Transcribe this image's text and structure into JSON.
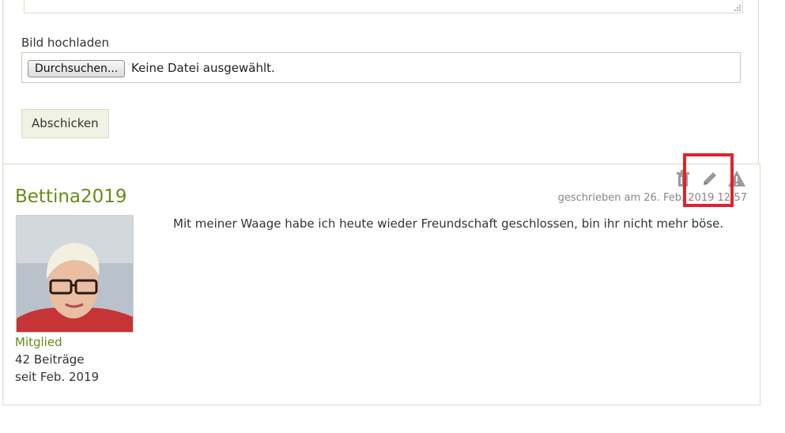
{
  "form": {
    "upload_label": "Bild hochladen",
    "browse_button": "Durchsuchen...",
    "no_file_text": "Keine Datei ausgewählt.",
    "submit_button": "Abschicken"
  },
  "post": {
    "username": "Bettina2019",
    "role": "Mitglied",
    "post_count": "42 Beiträge",
    "member_since": "seit Feb. 2019",
    "timestamp_prefix": "geschrieben am",
    "timestamp": "26. Feb. 2019 12:57",
    "message": "Mit meiner Waage habe ich heute wieder Freundschaft geschlossen, bin ihr nicht mehr böse.",
    "actions": [
      "trash-icon",
      "pencil-icon",
      "warning-icon"
    ]
  },
  "colors": {
    "accent_green": "#6a8a16",
    "border": "#d8dcc4",
    "button_bg": "#f1f2e3",
    "highlight_red": "#e0222a",
    "icon_gray": "#9a9a9a"
  }
}
